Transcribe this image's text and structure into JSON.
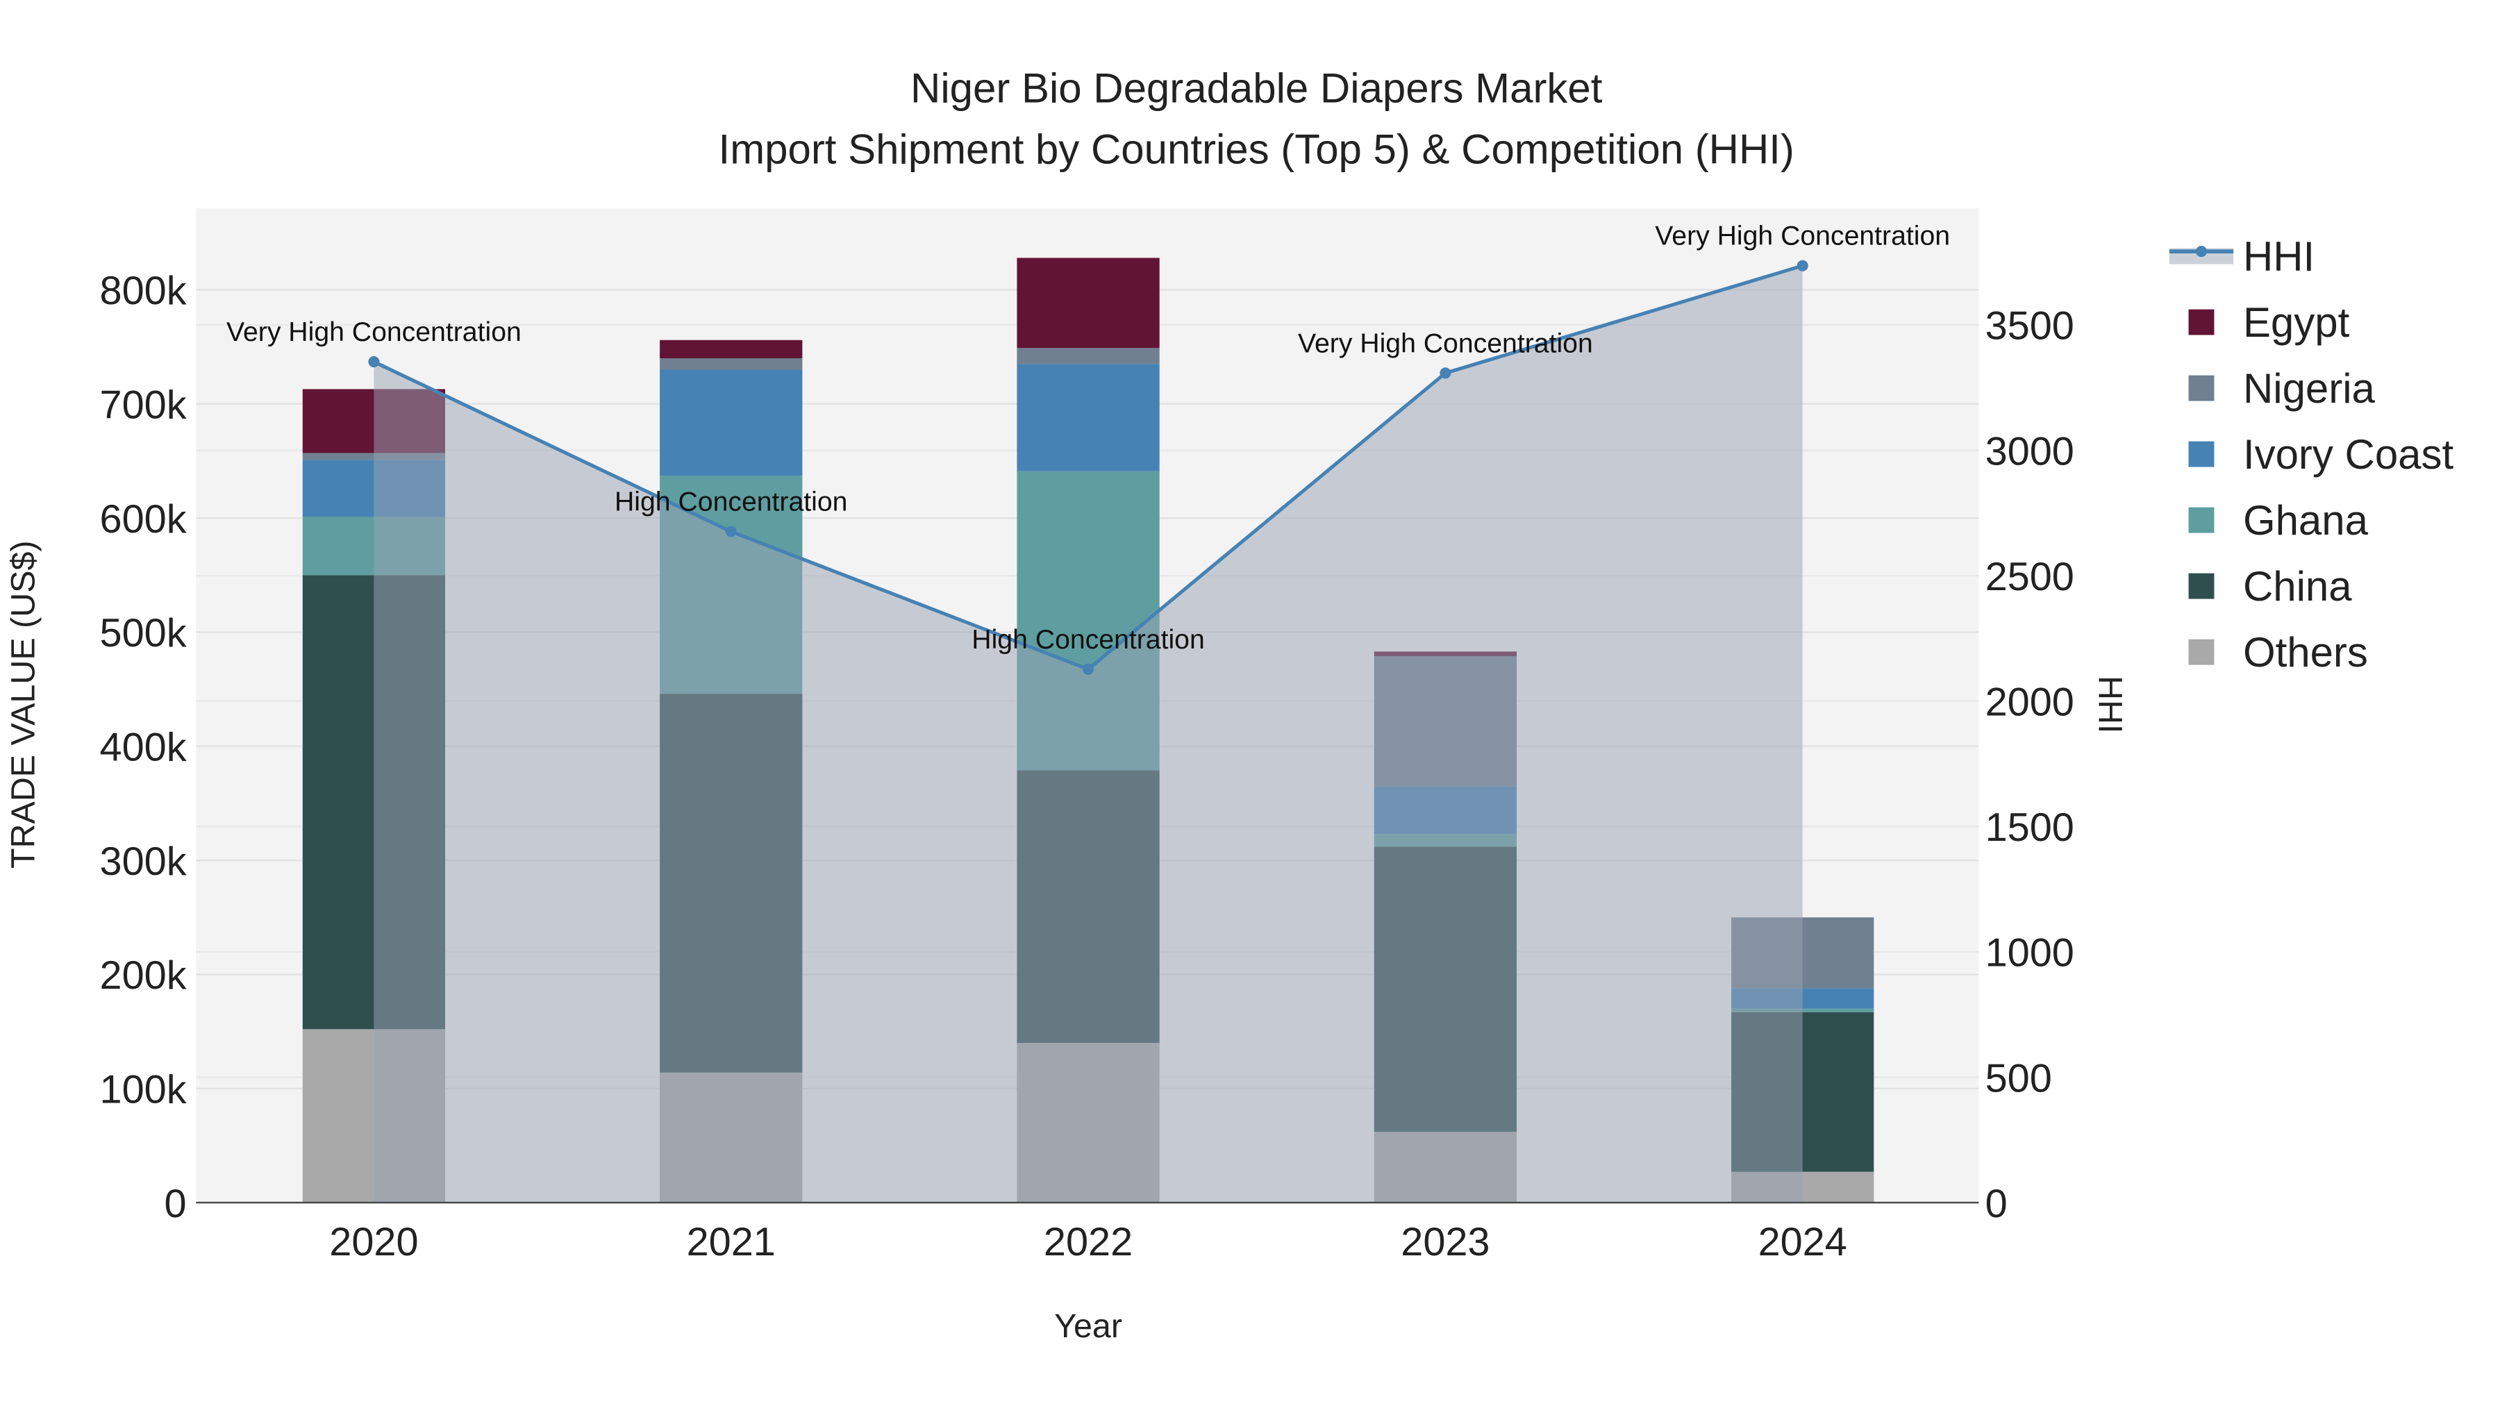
{
  "chart_data": {
    "type": "bar",
    "title": "Niger Bio Degradable Diapers Market",
    "subtitle": "Import Shipment by Countries (Top 5) & Competition (HHI)",
    "xlabel": "Year",
    "ylabel": "TRADE VALUE (US$)",
    "y2label": "HHI",
    "categories": [
      "2020",
      "2021",
      "2022",
      "2023",
      "2024"
    ],
    "ylim": [
      0,
      870000
    ],
    "y2lim": [
      0,
      3960
    ],
    "yticks": [
      0,
      100000,
      200000,
      300000,
      400000,
      500000,
      600000,
      700000,
      800000
    ],
    "ytick_labels": [
      "0",
      "100k",
      "200k",
      "300k",
      "400k",
      "500k",
      "600k",
      "700k",
      "800k"
    ],
    "y2ticks": [
      0,
      500,
      1000,
      1500,
      2000,
      2500,
      3000,
      3500
    ],
    "y2tick_labels": [
      "0",
      "500",
      "1000",
      "1500",
      "2000",
      "2500",
      "3000",
      "3500"
    ],
    "grid": true,
    "legend_placement": "right",
    "series": [
      {
        "name": "Others",
        "color": "#A9A9A9",
        "values": [
          152000,
          114000,
          140000,
          62000,
          27000
        ]
      },
      {
        "name": "China",
        "color": "#2F4F4F",
        "values": [
          398000,
          332000,
          239000,
          250000,
          140000
        ]
      },
      {
        "name": "Ghana",
        "color": "#5F9EA0",
        "values": [
          51000,
          191000,
          262000,
          11000,
          3000
        ]
      },
      {
        "name": "Ivory Coast",
        "color": "#4682B4",
        "values": [
          50000,
          93000,
          94000,
          42000,
          18000
        ]
      },
      {
        "name": "Nigeria",
        "color": "#708090",
        "values": [
          6000,
          10000,
          14000,
          114000,
          62000
        ]
      },
      {
        "name": "Egypt",
        "color": "#611434",
        "values": [
          56000,
          16000,
          79000,
          4000,
          0
        ]
      }
    ],
    "hhi": {
      "name": "HHI",
      "color": "#4682B4",
      "values": [
        3353,
        2676,
        2127,
        3308,
        3736
      ],
      "annotations": [
        "Very High Concentration",
        "High Concentration",
        "High Concentration",
        "Very High Concentration",
        "Very High Concentration"
      ]
    },
    "legend": [
      "HHI",
      "Egypt",
      "Nigeria",
      "Ivory Coast",
      "Ghana",
      "China",
      "Others"
    ]
  }
}
